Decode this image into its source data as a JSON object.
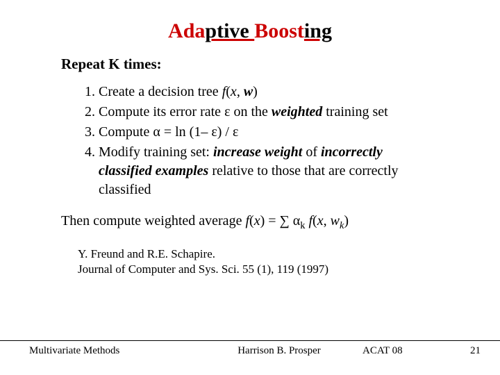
{
  "title": {
    "part1": "Ada",
    "part2": "ptive ",
    "part3": "Boost",
    "part4": "ing"
  },
  "repeat_heading": "Repeat K times:",
  "steps": {
    "s1": {
      "pre": "Create a decision tree ",
      "fx": "f",
      "paren_open": "(",
      "x": "x",
      "comma": ", ",
      "w": "w",
      "paren_close": ")"
    },
    "s2": {
      "pre": "Compute its error rate ",
      "eps": "ε",
      "mid": " on the ",
      "weighted": "weighted",
      "post": " training set"
    },
    "s3": {
      "pre": "Compute ",
      "alpha": "α",
      "eq": " = ln (1– ",
      "eps1": "ε",
      "mid": ") / ",
      "eps2": "ε"
    },
    "s4": {
      "pre": "Modify training set: ",
      "inc": "increase weight",
      "of": " of ",
      "bad": "incorrectly classified examples",
      "post": " relative to those that are correctly classified"
    }
  },
  "then": {
    "pre": "Then compute weighted average ",
    "fx": "f",
    "po": "(",
    "x": "x",
    "pc": ")",
    "eq": " = ∑ ",
    "alpha": "α",
    "sub_k1": "k",
    "sp": "  ",
    "f2": "f",
    "po2": "(",
    "x2": "x",
    "comma": ", ",
    "w": "w",
    "sub_k2": "k",
    "pc2": ")"
  },
  "reference": {
    "line1": "Y. Freund and R.E. Schapire.",
    "line2": "Journal of Computer and  Sys. Sci. 55 (1), 119 (1997)"
  },
  "footer": {
    "left": "Multivariate Methods",
    "center": "Harrison B. Prosper",
    "right1": "ACAT 08",
    "right2": "21"
  }
}
